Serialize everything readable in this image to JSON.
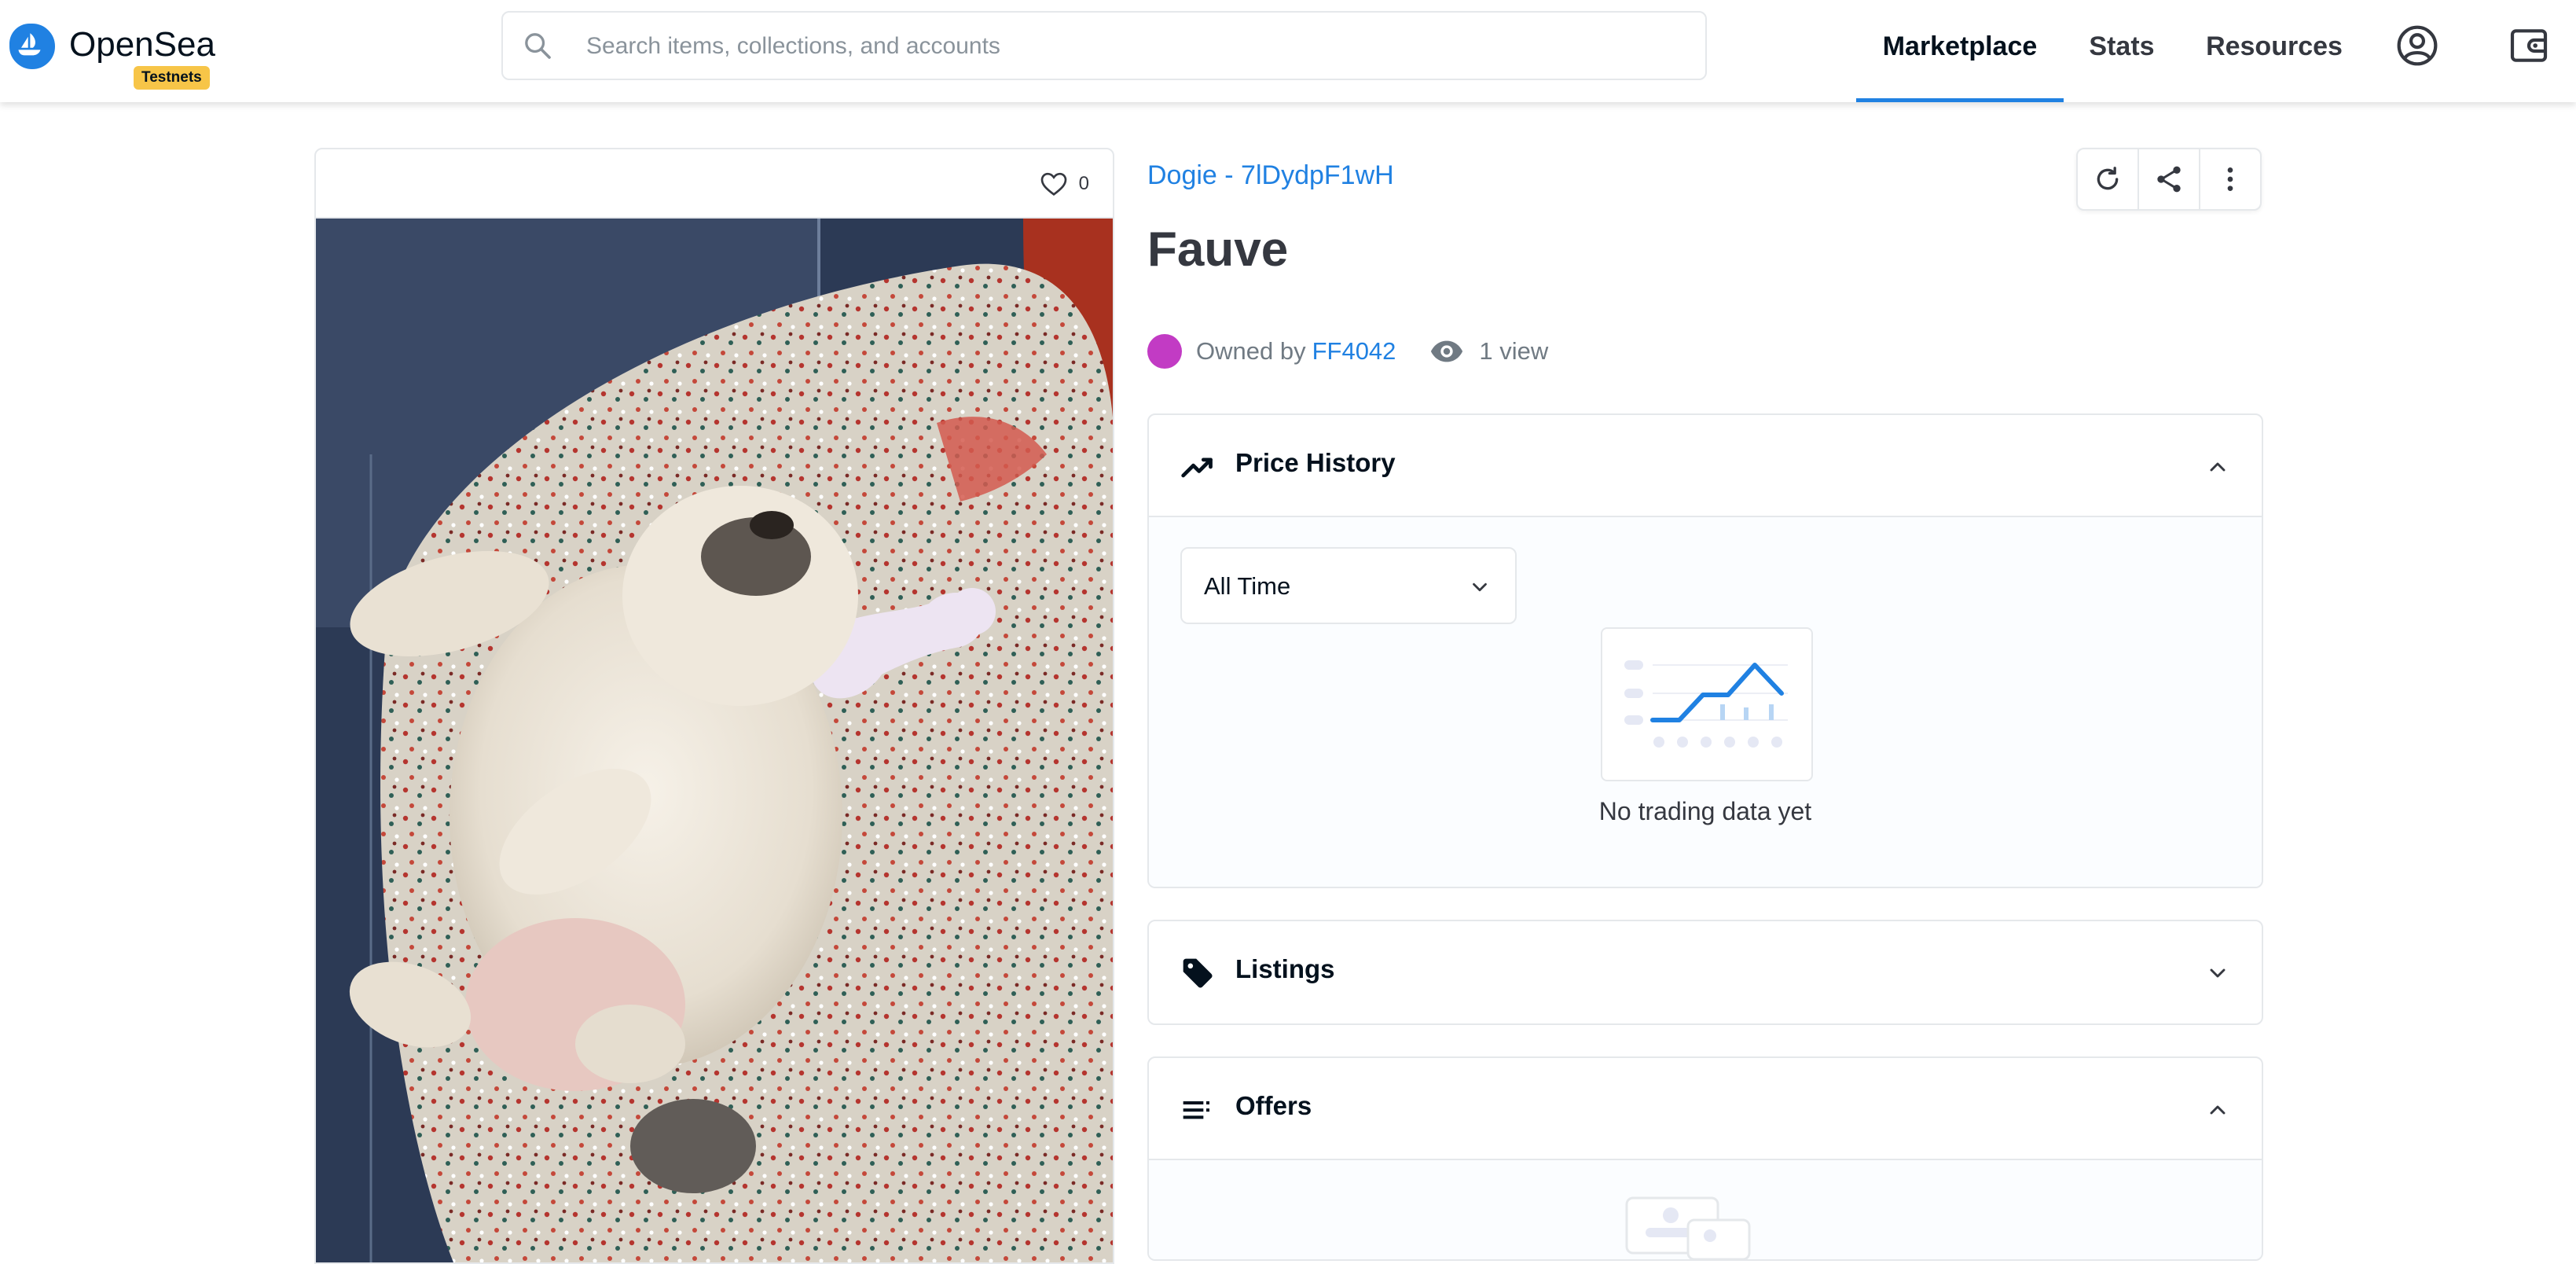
{
  "header": {
    "logo_text": "OpenSea",
    "testnets_badge": "Testnets",
    "search_placeholder": "Search items, collections, and accounts",
    "nav": [
      {
        "label": "Marketplace",
        "active": true
      },
      {
        "label": "Stats",
        "active": false
      },
      {
        "label": "Resources",
        "active": false
      }
    ],
    "icons": [
      "account-icon",
      "wallet-icon"
    ]
  },
  "asset": {
    "favorites_count": "0",
    "collection_name": "Dogie - 7lDydpF1wH",
    "title": "Fauve",
    "owned_by_label": "Owned by",
    "owner": "FF4042",
    "views": "1 view",
    "actions": [
      "refresh-icon",
      "share-icon",
      "more-options-icon"
    ]
  },
  "panels": {
    "price_history": {
      "title": "Price History",
      "expanded": true,
      "time_filter": "All Time",
      "empty_message": "No trading data yet"
    },
    "listings": {
      "title": "Listings",
      "expanded": false
    },
    "offers": {
      "title": "Offers",
      "expanded": true
    }
  },
  "colors": {
    "brand_blue": "#2081e2",
    "border": "#e5e8eb",
    "badge_yellow": "#f7c548",
    "owner_avatar": "#c23bc4"
  }
}
